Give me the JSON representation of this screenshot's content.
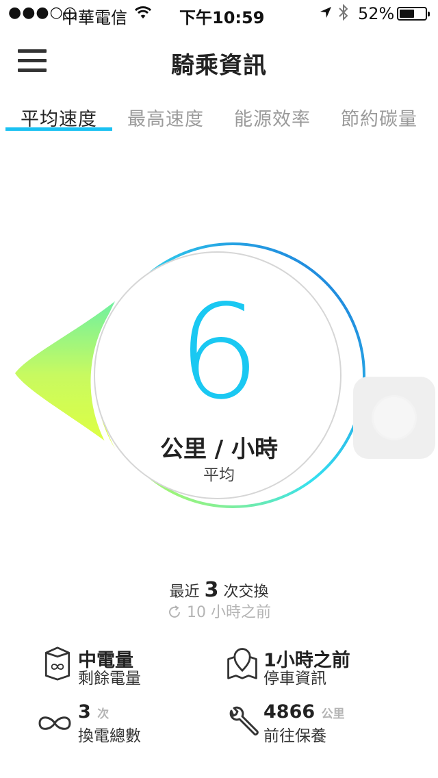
{
  "status_bar": {
    "signal": "●●●○○",
    "carrier": "中華電信",
    "time": "下午10:59",
    "battery": "52%"
  },
  "header": {
    "title": "騎乘資訊"
  },
  "tabs": [
    {
      "label": "平均速度",
      "active": true
    },
    {
      "label": "最高速度",
      "active": false
    },
    {
      "label": "能源效率",
      "active": false
    },
    {
      "label": "節約碳量",
      "active": false
    }
  ],
  "gauge": {
    "value": "6",
    "unit": "公里 / 小時",
    "subtitle": "平均",
    "accent_color": "#1ac8f2",
    "gradient_start": "#d6ff3a",
    "gradient_end": "#1a6fd8"
  },
  "recent": {
    "prefix": "最近",
    "count": "3",
    "suffix": "次交換",
    "ago": "10 小時之前"
  },
  "info": {
    "battery": {
      "main": "中電量",
      "sub": "剩餘電量"
    },
    "parking": {
      "main": "1小時之前",
      "sub": "停車資訊"
    },
    "swaps": {
      "main": "3",
      "unit": "次",
      "sub": "換電總數"
    },
    "service": {
      "main": "4866",
      "unit": "公里",
      "sub": "前往保養"
    }
  }
}
